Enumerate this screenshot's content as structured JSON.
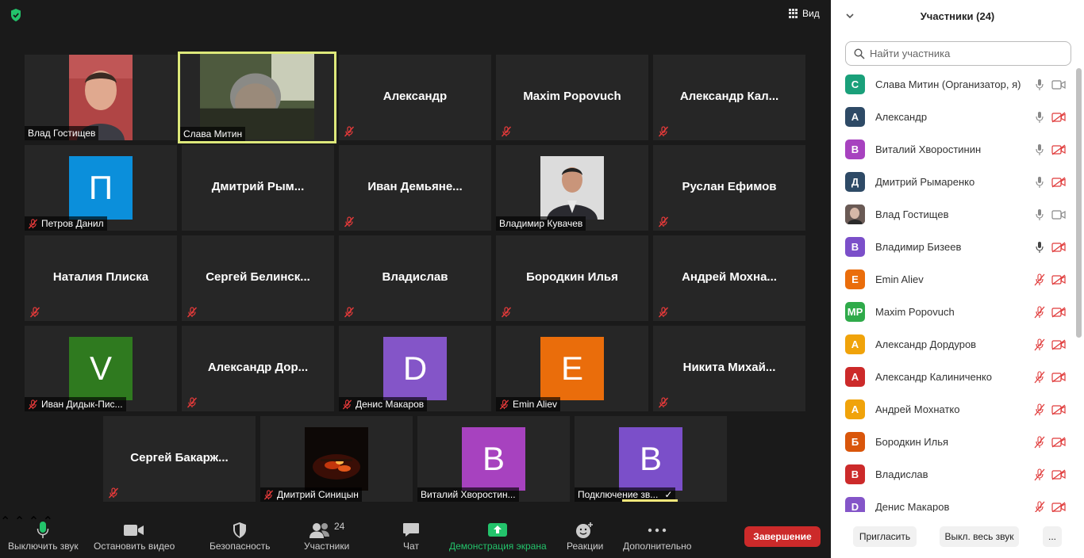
{
  "meeting": {
    "view_label": "Вид",
    "tiles": [
      {
        "name": "Влад Гостищев",
        "kind": "photo",
        "photo": "man-face"
      },
      {
        "name": "Слава Митин",
        "kind": "photo",
        "photo": "man-dark",
        "active": true
      },
      {
        "name": "Александр",
        "kind": "text",
        "muted": true
      },
      {
        "name": "Maxim Popovuch",
        "kind": "text",
        "muted": true
      },
      {
        "name": "Александр  Кал...",
        "kind": "text",
        "muted": true
      },
      {
        "name": "Петров Данил",
        "kind": "avatar",
        "letter": "П",
        "color": "#0b8fdb",
        "muted": true
      },
      {
        "name": "Дмитрий   Рым...",
        "kind": "text"
      },
      {
        "name": "Иван  Демьяне...",
        "kind": "text",
        "muted": true
      },
      {
        "name": "Владимир Кувачев",
        "kind": "photo",
        "photo": "man-suit"
      },
      {
        "name": "Руслан Ефимов",
        "kind": "text",
        "muted": true
      },
      {
        "name": "Наталия Плиска",
        "kind": "text",
        "muted": true
      },
      {
        "name": "Сергей  Белинск...",
        "kind": "text",
        "muted": true
      },
      {
        "name": "Владислав",
        "kind": "text",
        "muted": true
      },
      {
        "name": "Бородкин Илья",
        "kind": "text",
        "muted": true
      },
      {
        "name": "Андрей  Мохна...",
        "kind": "text",
        "muted": true
      },
      {
        "name": "Иван Дидык-Пис...",
        "kind": "avatar",
        "letter": "V",
        "color": "#2f7a1f",
        "muted": true
      },
      {
        "name": "Александр  Дор...",
        "kind": "text",
        "muted": true
      },
      {
        "name": "Денис Макаров",
        "kind": "avatar",
        "letter": "D",
        "color": "#8455c8",
        "muted": true
      },
      {
        "name": "Emin Aliev",
        "kind": "avatar",
        "letter": "E",
        "color": "#ea6d0b",
        "muted": true
      },
      {
        "name": "Никита  Михай...",
        "kind": "text",
        "muted": true
      },
      {
        "name": "Сергей  Бакарж...",
        "kind": "text",
        "muted": true
      },
      {
        "name": "Дмитрий Синицын",
        "kind": "photo",
        "photo": "fire",
        "muted": true
      },
      {
        "name": "Виталий Хворостин...",
        "kind": "avatar",
        "letter": "В",
        "color": "#a742bf"
      },
      {
        "name": "Подключение зв...",
        "kind": "avatar",
        "letter": "В",
        "color": "#7b4fc9",
        "connecting": true
      }
    ]
  },
  "toolbar": {
    "mute_label": "Выключить звук",
    "video_label": "Остановить видео",
    "security_label": "Безопасность",
    "participants_label": "Участники",
    "participants_count": "24",
    "chat_label": "Чат",
    "share_label": "Демонстрация экрана",
    "reactions_label": "Реакции",
    "more_label": "Дополнительно",
    "end_label": "Завершение",
    "share_color": "#23c36b",
    "end_color": "#cc2a2a"
  },
  "panel": {
    "title": "Участники (24)",
    "search_placeholder": "Найти участника",
    "participants": [
      {
        "initials": "С",
        "color": "#1aa07a",
        "name": "Слава Митин (Организатор, я)",
        "mic": "on",
        "cam": "on"
      },
      {
        "initials": "А",
        "color": "#2e4a66",
        "name": "Александр",
        "mic": "on",
        "cam": "off"
      },
      {
        "initials": "В",
        "color": "#a742bf",
        "name": "Виталий Хворостинин",
        "mic": "on",
        "cam": "off"
      },
      {
        "initials": "Д",
        "color": "#2e4a66",
        "name": "Дмитрий  Рымаренко",
        "mic": "on",
        "cam": "off"
      },
      {
        "initials": "",
        "color": "#555555",
        "name": "Влад Гостищев",
        "mic": "on",
        "cam": "on",
        "photo": true
      },
      {
        "initials": "В",
        "color": "#7b4fc9",
        "name": "Владимир Бизеев",
        "mic": "on-dark",
        "cam": "off"
      },
      {
        "initials": "E",
        "color": "#ea6d0b",
        "name": "Emin Aliev",
        "mic": "off",
        "cam": "off"
      },
      {
        "initials": "MP",
        "color": "#2faa4a",
        "name": "Maxim Popovuch",
        "mic": "off",
        "cam": "off"
      },
      {
        "initials": "А",
        "color": "#f0a30a",
        "name": "Александр Дордуров",
        "mic": "off",
        "cam": "off"
      },
      {
        "initials": "А",
        "color": "#cc2a2a",
        "name": "Александр Калиниченко",
        "mic": "off",
        "cam": "off"
      },
      {
        "initials": "А",
        "color": "#f0a30a",
        "name": "Андрей Мохнатко",
        "mic": "off",
        "cam": "off"
      },
      {
        "initials": "Б",
        "color": "#d9560b",
        "name": "Бородкин Илья",
        "mic": "off",
        "cam": "off"
      },
      {
        "initials": "В",
        "color": "#cc2a2a",
        "name": "Владислав",
        "mic": "off",
        "cam": "off"
      },
      {
        "initials": "D",
        "color": "#8455c8",
        "name": "Денис Макаров",
        "mic": "off",
        "cam": "off"
      }
    ],
    "invite_label": "Пригласить",
    "mute_all_label": "Выкл. весь звук",
    "more_label": "..."
  }
}
